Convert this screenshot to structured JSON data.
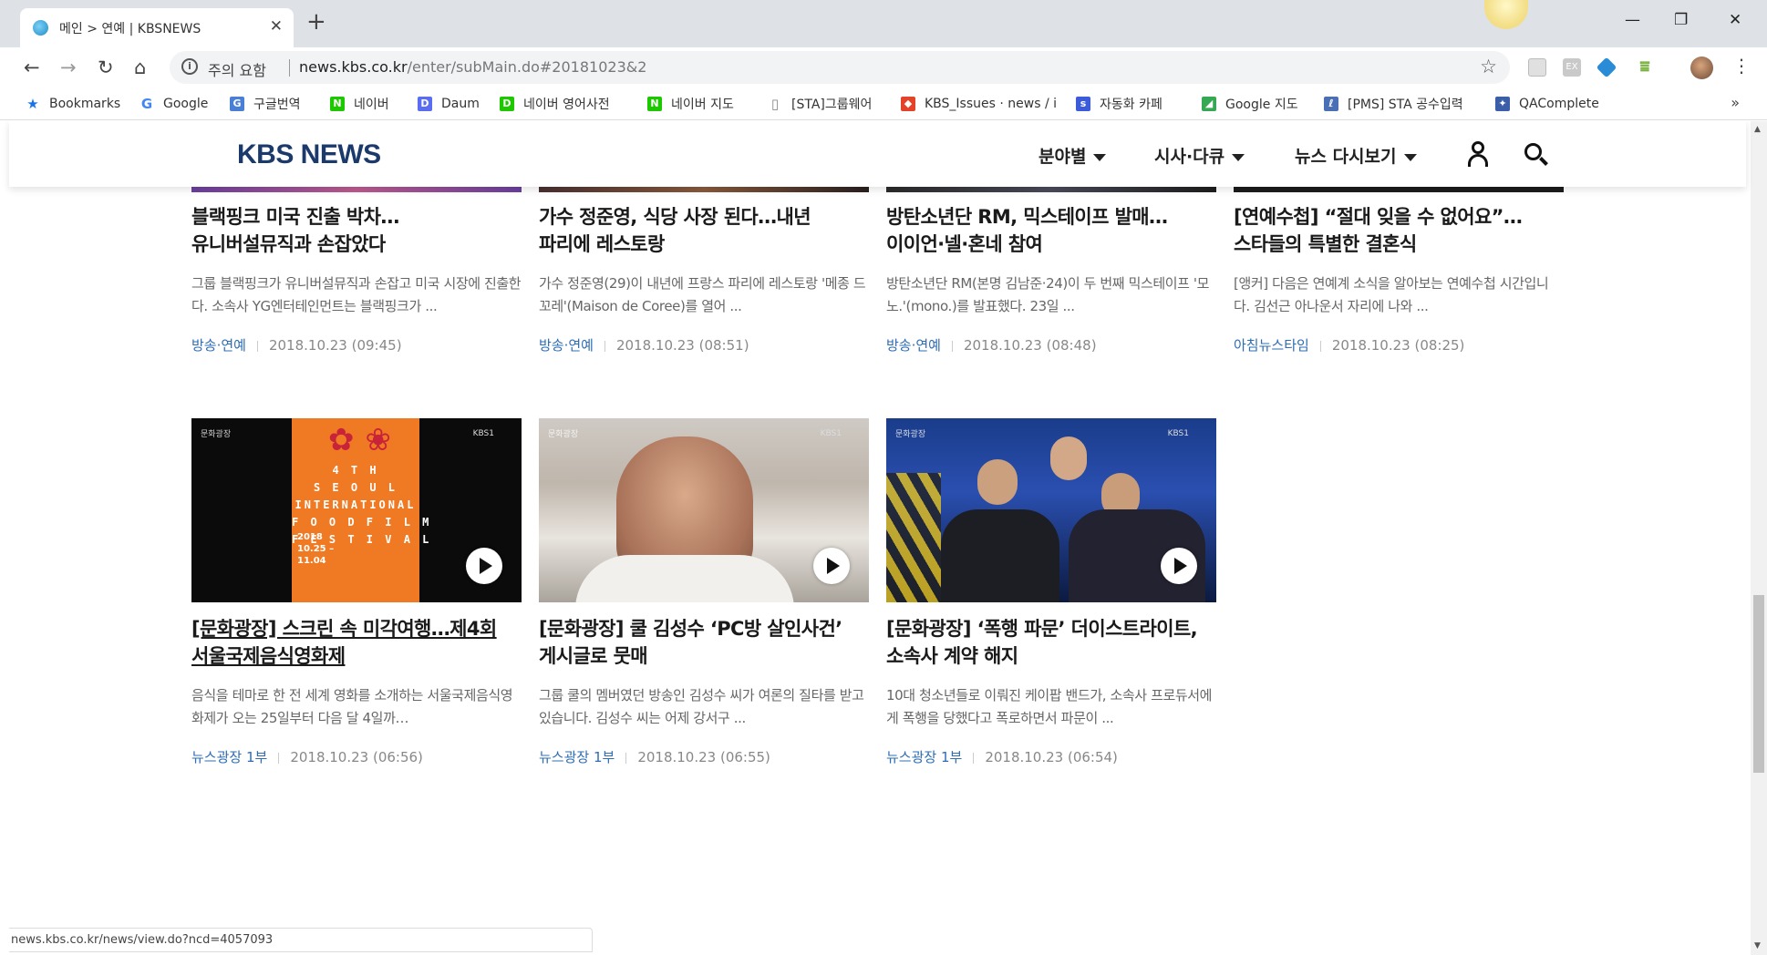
{
  "browser": {
    "tab_title": "메인 > 연예 | KBSNEWS",
    "tab_close": "✕",
    "new_tab": "+",
    "window_controls": [
      "—",
      "❐",
      "✕"
    ],
    "nav": {
      "back": "←",
      "forward": "→",
      "reload": "↻",
      "home": "⌂"
    },
    "omnibox": {
      "info": "i",
      "security_label": "주의 요함",
      "url_host": "news.kbs.co.kr",
      "url_path": "/enter/subMain.do#20181023&2",
      "star": "☆"
    },
    "extensions": [
      "EX"
    ],
    "menu": "⋮",
    "bookmarks": [
      {
        "label": "Bookmarks",
        "icon": "star-icon",
        "glyph": "★",
        "color": "#1a73e8"
      },
      {
        "label": "Google",
        "icon": "google-icon",
        "glyph": "G",
        "color": "#4285f4"
      },
      {
        "label": "구글번역",
        "icon": "translate-icon",
        "glyph": "G",
        "color": "#4a7fd6"
      },
      {
        "label": "네이버",
        "icon": "naver-icon",
        "glyph": "N",
        "color": "#1ec800"
      },
      {
        "label": "Daum",
        "icon": "daum-icon",
        "glyph": "D",
        "color": "#5a6cf0"
      },
      {
        "label": "네이버 영어사전",
        "icon": "dict-icon",
        "glyph": "D",
        "color": "#1ec800"
      },
      {
        "label": "네이버 지도",
        "icon": "naver-icon",
        "glyph": "N",
        "color": "#1ec800"
      },
      {
        "label": "[STA]그룹웨어",
        "icon": "page-icon",
        "glyph": "▯",
        "color": "#888888"
      },
      {
        "label": "KBS_Issues · news / i",
        "icon": "gitlab-icon",
        "glyph": "◆",
        "color": "#e24329"
      },
      {
        "label": "자동화 카페",
        "icon": "cafe-icon",
        "glyph": "s",
        "color": "#3b5bdb"
      },
      {
        "label": "Google 지도",
        "icon": "maps-icon",
        "glyph": "◢",
        "color": "#34a853"
      },
      {
        "label": "[PMS] STA 공수입력",
        "icon": "pms-icon",
        "glyph": "ℓ",
        "color": "#4a6fb5"
      },
      {
        "label": "QAComplete",
        "icon": "qa-icon",
        "glyph": "✦",
        "color": "#3a5ea8"
      }
    ],
    "bookmarks_more": "»",
    "status_url": "news.kbs.co.kr/news/view.do?ncd=4057093"
  },
  "site": {
    "logo": "KBS NEWS",
    "menu": [
      {
        "label": "분야별"
      },
      {
        "label": "시사·다큐"
      },
      {
        "label": "뉴스 다시보기"
      }
    ]
  },
  "articles_row1": [
    {
      "title_line1": "블랙핑크 미국 진출 박차…",
      "title_line2": "유니버설뮤직과 손잡았다",
      "summary": "그룹 블랙핑크가 유니버설뮤직과 손잡고 미국 시장에 진출한다. 소속사 YG엔터테인먼트는 블랙핑크가 ...",
      "category": "방송·연예",
      "date": "2018.10.23 (09:45)",
      "strip_color": "#6a3fa0"
    },
    {
      "title_line1": "가수 정준영, 식당 사장 된다…내년",
      "title_line2": "파리에 레스토랑",
      "summary": "가수 정준영(29)이 내년에 프랑스 파리에 레스토랑 '메종 드 꼬레'(Maison de Coree)를 열어 ...",
      "category": "방송·연예",
      "date": "2018.10.23 (08:51)",
      "strip_color": "#3a2a2a"
    },
    {
      "title_line1": "방탄소년단 RM, 믹스테이프 발매…",
      "title_line2": "이이언·넬·혼네 참여",
      "summary": "방탄소년단 RM(본명 김남준·24)이 두 번째 믹스테이프 '모노.'(mono.)를 발표했다. 23일 ...",
      "category": "방송·연예",
      "date": "2018.10.23 (08:48)",
      "strip_color": "#2b2b2b"
    },
    {
      "title_line1": "[연예수첩] “절대 잊을 수 없어요”…",
      "title_line2": "스타들의 특별한 결혼식",
      "summary": "[앵커] 다음은 연예계 소식을 알아보는 연예수첩 시간입니다. 김선근 아나운서 자리에 나와 ...",
      "category": "아침뉴스타임",
      "date": "2018.10.23 (08:25)",
      "strip_color": "#1c1c1c"
    }
  ],
  "articles_row2": [
    {
      "title_line1": "[문화광장] 스크린 속 미각여행…제4회",
      "title_line2": "서울국제음식영화제",
      "summary": "음식을 테마로 한 전 세계 영화를 소개하는 서울국제음식영화제가 오는 25일부터 다음 달 4일까…",
      "category": "뉴스광장 1부",
      "date": "2018.10.23 (06:56)",
      "poster_text": "4 T H\nS E O U L\nINTERNATIONAL\nF O O D F I L M\nF E S T I V A L",
      "poster_date": "2018\n10.25 –\n11.04",
      "thumb_logo": "문화광장",
      "thumb_channel": "KBS1"
    },
    {
      "title_line1": "[문화광장] 쿨 김성수 ‘PC방 살인사건’",
      "title_line2": "게시글로 뭇매",
      "summary": "그룹 쿨의 멤버였던 방송인 김성수 씨가 여론의 질타를 받고 있습니다. 김성수 씨는 어제 강서구 ...",
      "category": "뉴스광장 1부",
      "date": "2018.10.23 (06:55)",
      "thumb_logo": "문화광장",
      "thumb_channel": "KBS1"
    },
    {
      "title_line1": "[문화광장] ‘폭행 파문’ 더이스트라이트,",
      "title_line2": "소속사 계약 해지",
      "summary": "10대 청소년들로 이뤄진 케이팝 밴드가, 소속사 프로듀서에게 폭행을 당했다고 폭로하면서 파문이 ...",
      "category": "뉴스광장 1부",
      "date": "2018.10.23 (06:54)",
      "thumb_logo": "문화광장",
      "thumb_channel": "KBS1"
    }
  ]
}
